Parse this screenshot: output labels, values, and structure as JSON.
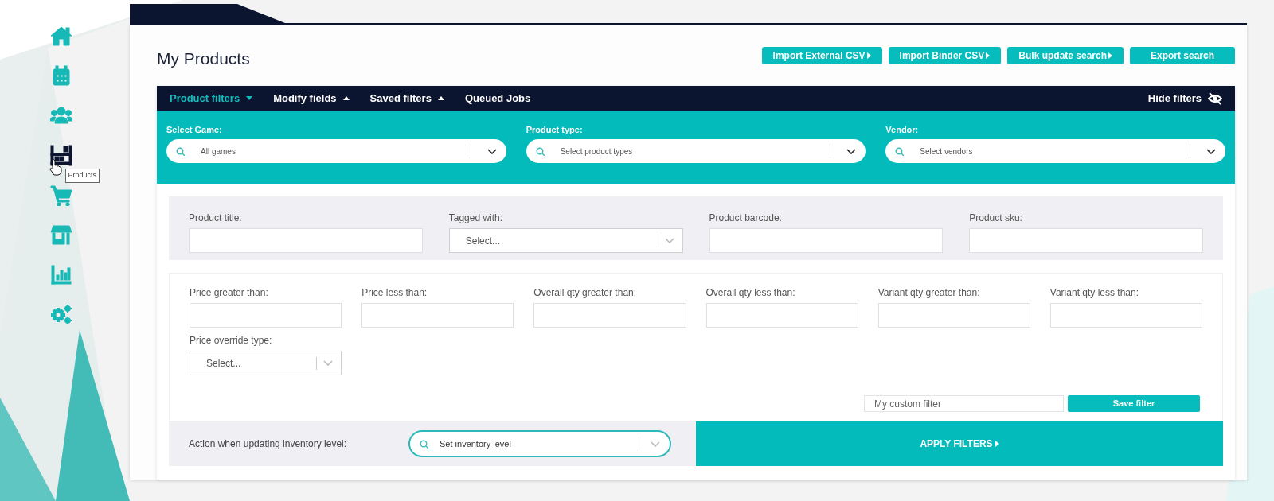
{
  "sidebar": {
    "items": [
      {
        "kind": "home",
        "selected": false
      },
      {
        "kind": "calendar",
        "selected": false
      },
      {
        "kind": "people",
        "selected": false
      },
      {
        "kind": "shelf",
        "selected": true,
        "tooltip": "Products"
      },
      {
        "kind": "cart",
        "selected": false
      },
      {
        "kind": "store",
        "selected": false
      },
      {
        "kind": "chart",
        "selected": false
      },
      {
        "kind": "gears",
        "selected": false
      }
    ]
  },
  "page": {
    "title": "My Products",
    "actions": [
      {
        "label": "Import External CSV",
        "caret": true
      },
      {
        "label": "Import Binder CSV",
        "caret": true
      },
      {
        "label": "Bulk update search",
        "caret": true
      },
      {
        "label": "Export search",
        "caret": false
      }
    ]
  },
  "filter_tabs": [
    {
      "label": "Product filters",
      "selected": true,
      "expanded": true
    },
    {
      "label": "Modify fields",
      "selected": false,
      "expanded": false
    },
    {
      "label": "Saved filters",
      "selected": false,
      "expanded": false
    },
    {
      "label": "Queued Jobs",
      "selected": false
    }
  ],
  "hide_filters": {
    "label": "Hide filters"
  },
  "top_selects": [
    {
      "label": "Select Game:",
      "value": "All games"
    },
    {
      "label": "Product type:",
      "placeholder": "Select product types"
    },
    {
      "label": "Vendor:",
      "placeholder": "Select vendors"
    }
  ],
  "text_filters": [
    {
      "label": "Product title:",
      "kind": "text"
    },
    {
      "label": "Tagged with:",
      "kind": "select",
      "placeholder": "Select..."
    },
    {
      "label": "Product barcode:",
      "kind": "text"
    },
    {
      "label": "Product sku:",
      "kind": "text"
    }
  ],
  "number_filters": [
    {
      "label": "Price greater than:",
      "kind": "text"
    },
    {
      "label": "Price less than:",
      "kind": "text"
    },
    {
      "label": "Overall qty greater than:",
      "kind": "text"
    },
    {
      "label": "Overall qty less than:",
      "kind": "text"
    },
    {
      "label": "Variant qty greater than:",
      "kind": "text"
    },
    {
      "label": "Variant qty less than:",
      "kind": "text"
    },
    {
      "label": "Price override type:",
      "kind": "select",
      "placeholder": "Select..."
    }
  ],
  "custom_filter": {
    "placeholder": "My custom filter",
    "button": "Save filter"
  },
  "inventory_action": {
    "label": "Action when updating inventory level:",
    "value": "Set inventory level"
  },
  "apply": {
    "label": "APPLY FILTERS",
    "caret": true
  }
}
